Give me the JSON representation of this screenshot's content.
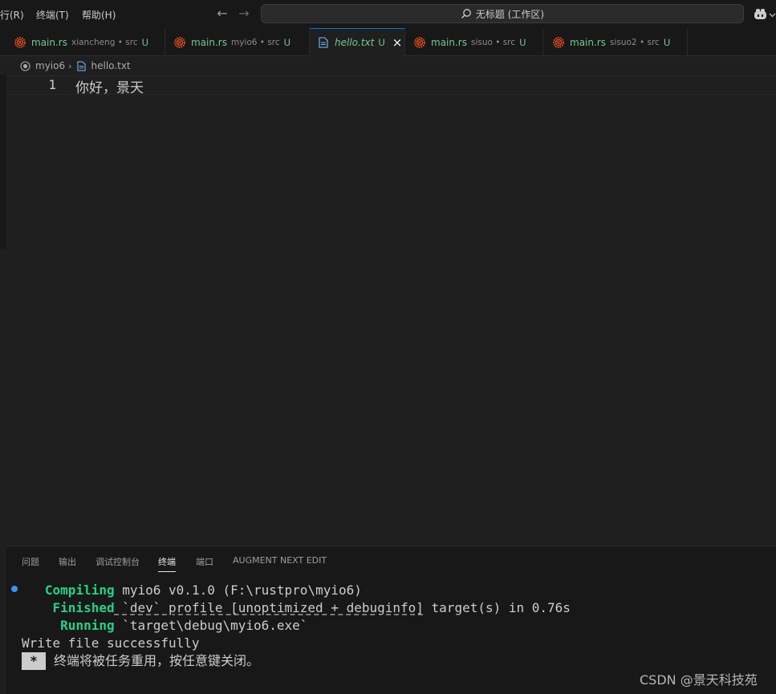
{
  "menu": {
    "items": [
      "行(R)",
      "终端(T)",
      "帮助(H)"
    ]
  },
  "title_bar": {
    "search_label": "无标题 (工作区)"
  },
  "tabs": [
    {
      "name": "main.rs",
      "description": "xiancheng • src",
      "status": "U",
      "icon": "rust-icon"
    },
    {
      "name": "main.rs",
      "description": "myio6 • src",
      "status": "U",
      "icon": "rust-icon"
    },
    {
      "name": "hello.txt",
      "description": "",
      "status": "U",
      "icon": "file-icon"
    },
    {
      "name": "main.rs",
      "description": "sisuo • src",
      "status": "U",
      "icon": "rust-icon"
    },
    {
      "name": "main.rs",
      "description": "sisuo2 • src",
      "status": "U",
      "icon": "rust-icon"
    }
  ],
  "breadcrumb": {
    "folder": "myio6",
    "file": "hello.txt"
  },
  "editor": {
    "line_number": "1",
    "line_text": "你好，景天"
  },
  "panel": {
    "tabs": [
      "问题",
      "输出",
      "调试控制台",
      "终端",
      "端口",
      "AUGMENT NEXT EDIT"
    ],
    "active_tab": "终端"
  },
  "terminal": {
    "compiling_label": "Compiling",
    "compiling_rest": " myio6 v0.1.0 (F:\\rustpro\\myio6)",
    "finished_label": "Finished",
    "finished_profile": " `dev` profile [unoptimized + debuginfo]",
    "finished_rest": " target(s) in 0.76s",
    "running_label": "Running",
    "running_rest": " `target\\debug\\myio6.exe`",
    "output_line": "Write file successfully",
    "star": "*",
    "reuse_line": "终端将被任务重用，按任意键关闭。"
  },
  "watermark": "CSDN @景天科技苑",
  "colors": {
    "accent": "#0078d4",
    "git_untracked": "#73c991",
    "terminal_green": "#23d18b",
    "rust_icon": "#f4511e"
  }
}
